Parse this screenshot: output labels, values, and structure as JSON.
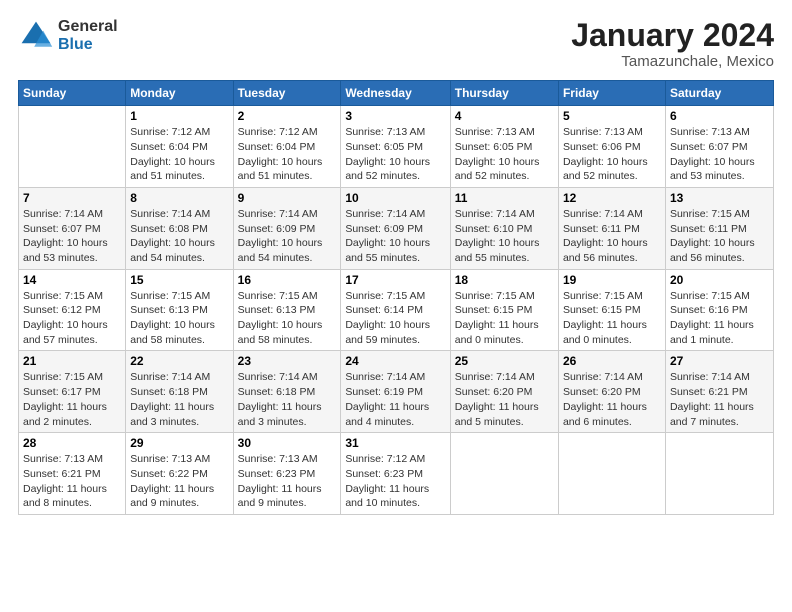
{
  "header": {
    "logo_general": "General",
    "logo_blue": "Blue",
    "title": "January 2024",
    "subtitle": "Tamazunchale, Mexico"
  },
  "days_of_week": [
    "Sunday",
    "Monday",
    "Tuesday",
    "Wednesday",
    "Thursday",
    "Friday",
    "Saturday"
  ],
  "weeks": [
    [
      {
        "day": "",
        "info": ""
      },
      {
        "day": "1",
        "info": "Sunrise: 7:12 AM\nSunset: 6:04 PM\nDaylight: 10 hours\nand 51 minutes."
      },
      {
        "day": "2",
        "info": "Sunrise: 7:12 AM\nSunset: 6:04 PM\nDaylight: 10 hours\nand 51 minutes."
      },
      {
        "day": "3",
        "info": "Sunrise: 7:13 AM\nSunset: 6:05 PM\nDaylight: 10 hours\nand 52 minutes."
      },
      {
        "day": "4",
        "info": "Sunrise: 7:13 AM\nSunset: 6:05 PM\nDaylight: 10 hours\nand 52 minutes."
      },
      {
        "day": "5",
        "info": "Sunrise: 7:13 AM\nSunset: 6:06 PM\nDaylight: 10 hours\nand 52 minutes."
      },
      {
        "day": "6",
        "info": "Sunrise: 7:13 AM\nSunset: 6:07 PM\nDaylight: 10 hours\nand 53 minutes."
      }
    ],
    [
      {
        "day": "7",
        "info": "Sunrise: 7:14 AM\nSunset: 6:07 PM\nDaylight: 10 hours\nand 53 minutes."
      },
      {
        "day": "8",
        "info": "Sunrise: 7:14 AM\nSunset: 6:08 PM\nDaylight: 10 hours\nand 54 minutes."
      },
      {
        "day": "9",
        "info": "Sunrise: 7:14 AM\nSunset: 6:09 PM\nDaylight: 10 hours\nand 54 minutes."
      },
      {
        "day": "10",
        "info": "Sunrise: 7:14 AM\nSunset: 6:09 PM\nDaylight: 10 hours\nand 55 minutes."
      },
      {
        "day": "11",
        "info": "Sunrise: 7:14 AM\nSunset: 6:10 PM\nDaylight: 10 hours\nand 55 minutes."
      },
      {
        "day": "12",
        "info": "Sunrise: 7:14 AM\nSunset: 6:11 PM\nDaylight: 10 hours\nand 56 minutes."
      },
      {
        "day": "13",
        "info": "Sunrise: 7:15 AM\nSunset: 6:11 PM\nDaylight: 10 hours\nand 56 minutes."
      }
    ],
    [
      {
        "day": "14",
        "info": "Sunrise: 7:15 AM\nSunset: 6:12 PM\nDaylight: 10 hours\nand 57 minutes."
      },
      {
        "day": "15",
        "info": "Sunrise: 7:15 AM\nSunset: 6:13 PM\nDaylight: 10 hours\nand 58 minutes."
      },
      {
        "day": "16",
        "info": "Sunrise: 7:15 AM\nSunset: 6:13 PM\nDaylight: 10 hours\nand 58 minutes."
      },
      {
        "day": "17",
        "info": "Sunrise: 7:15 AM\nSunset: 6:14 PM\nDaylight: 10 hours\nand 59 minutes."
      },
      {
        "day": "18",
        "info": "Sunrise: 7:15 AM\nSunset: 6:15 PM\nDaylight: 11 hours\nand 0 minutes."
      },
      {
        "day": "19",
        "info": "Sunrise: 7:15 AM\nSunset: 6:15 PM\nDaylight: 11 hours\nand 0 minutes."
      },
      {
        "day": "20",
        "info": "Sunrise: 7:15 AM\nSunset: 6:16 PM\nDaylight: 11 hours\nand 1 minute."
      }
    ],
    [
      {
        "day": "21",
        "info": "Sunrise: 7:15 AM\nSunset: 6:17 PM\nDaylight: 11 hours\nand 2 minutes."
      },
      {
        "day": "22",
        "info": "Sunrise: 7:14 AM\nSunset: 6:18 PM\nDaylight: 11 hours\nand 3 minutes."
      },
      {
        "day": "23",
        "info": "Sunrise: 7:14 AM\nSunset: 6:18 PM\nDaylight: 11 hours\nand 3 minutes."
      },
      {
        "day": "24",
        "info": "Sunrise: 7:14 AM\nSunset: 6:19 PM\nDaylight: 11 hours\nand 4 minutes."
      },
      {
        "day": "25",
        "info": "Sunrise: 7:14 AM\nSunset: 6:20 PM\nDaylight: 11 hours\nand 5 minutes."
      },
      {
        "day": "26",
        "info": "Sunrise: 7:14 AM\nSunset: 6:20 PM\nDaylight: 11 hours\nand 6 minutes."
      },
      {
        "day": "27",
        "info": "Sunrise: 7:14 AM\nSunset: 6:21 PM\nDaylight: 11 hours\nand 7 minutes."
      }
    ],
    [
      {
        "day": "28",
        "info": "Sunrise: 7:13 AM\nSunset: 6:21 PM\nDaylight: 11 hours\nand 8 minutes."
      },
      {
        "day": "29",
        "info": "Sunrise: 7:13 AM\nSunset: 6:22 PM\nDaylight: 11 hours\nand 9 minutes."
      },
      {
        "day": "30",
        "info": "Sunrise: 7:13 AM\nSunset: 6:23 PM\nDaylight: 11 hours\nand 9 minutes."
      },
      {
        "day": "31",
        "info": "Sunrise: 7:12 AM\nSunset: 6:23 PM\nDaylight: 11 hours\nand 10 minutes."
      },
      {
        "day": "",
        "info": ""
      },
      {
        "day": "",
        "info": ""
      },
      {
        "day": "",
        "info": ""
      }
    ]
  ]
}
